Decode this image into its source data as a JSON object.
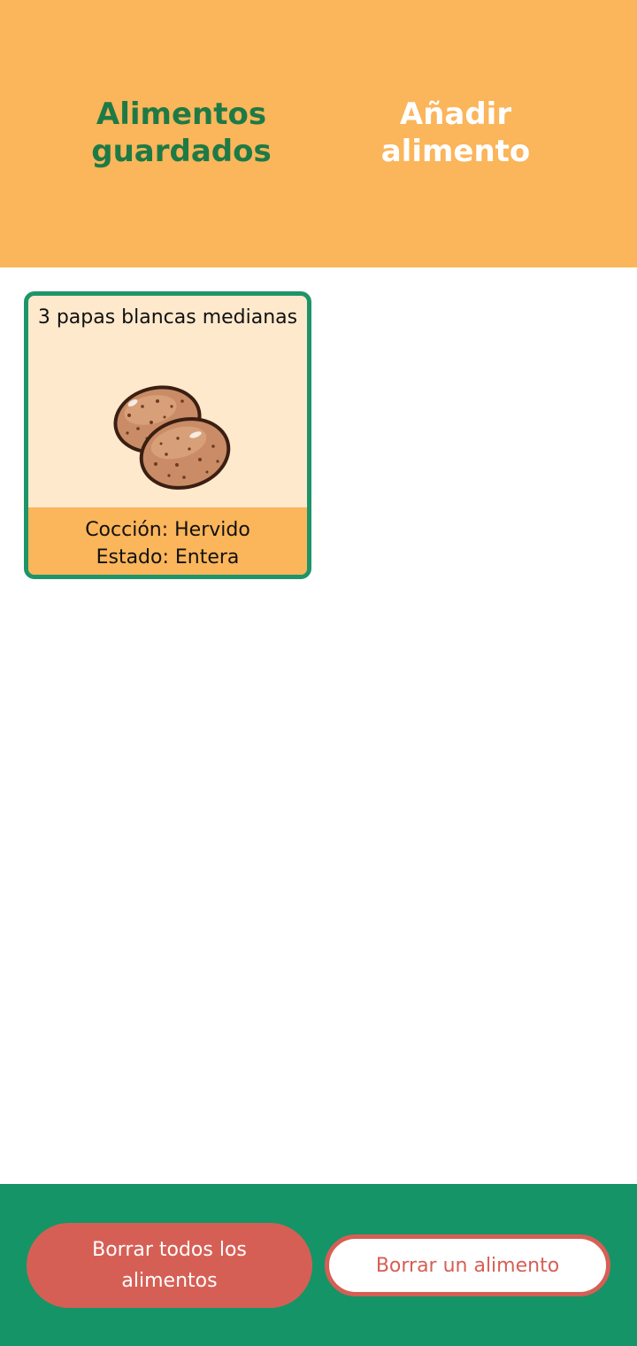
{
  "header": {
    "tabs": [
      {
        "label": "Alimentos guardados",
        "active": true
      },
      {
        "label": "Añadir alimento",
        "active": false
      }
    ],
    "background_color": "#FBB55A",
    "active_color": "#1E7A45",
    "inactive_color": "#FFFFFF"
  },
  "foods": [
    {
      "name": "3 papas blancas medianas",
      "icon": "potatoes-icon",
      "coccion_line": "Cocción: Hervido",
      "estado_line": "Estado: Entera"
    }
  ],
  "footer": {
    "delete_all_label": "Borrar todos los alimentos",
    "delete_one_label": "Borrar un alimento",
    "background_color": "#159467",
    "danger_color": "#D65F55"
  }
}
